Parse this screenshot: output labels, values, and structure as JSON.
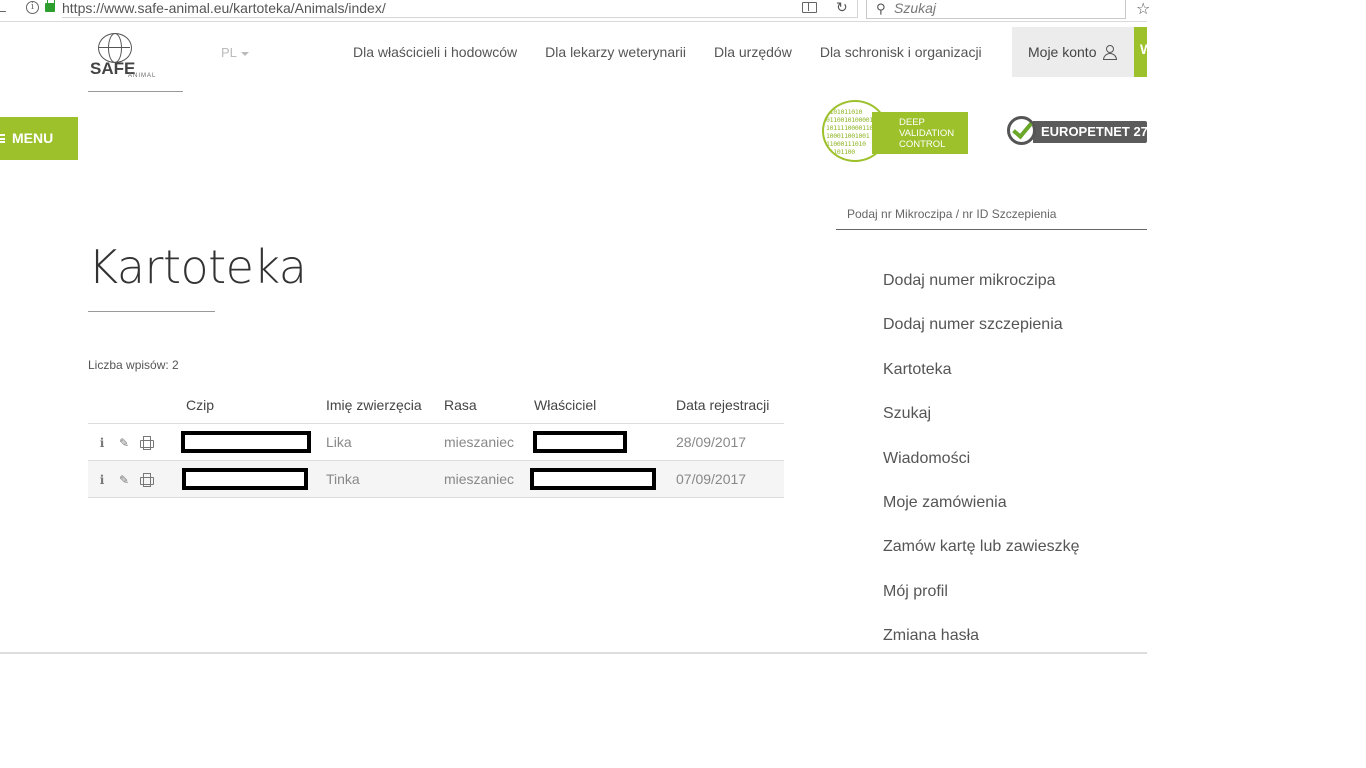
{
  "browser": {
    "url": "https://www.safe-animal.eu/kartoteka/Animals/index/",
    "search_placeholder": "Szukaj"
  },
  "logo": {
    "text": "SAFE",
    "sub": "ANIMAL"
  },
  "lang": "PL",
  "nav": {
    "items": [
      {
        "label": "Dla właścicieli i hodowców"
      },
      {
        "label": "Dla lekarzy weterynarii"
      },
      {
        "label": "Dla urzędów"
      },
      {
        "label": "Dla schronisk i organizacji"
      }
    ],
    "account": "Moje konto",
    "extra": "W"
  },
  "menu_label": "MENU",
  "badges": {
    "dvc_binary": "1101011010\n0110010100001\n10111100001100\n100011001001\n11000111010\n01101100",
    "dvc_lines": [
      "DEEP",
      "VALIDATION",
      "CONTROL"
    ],
    "europet": "EUROPETNET 27"
  },
  "chip_search": {
    "placeholder": "Podaj nr Mikroczipa / nr ID Szczepienia"
  },
  "side_menu": [
    "Dodaj numer mikroczipa",
    "Dodaj numer szczepienia",
    "Kartoteka",
    "Szukaj",
    "Wiadomości",
    "Moje zamówienia",
    "Zamów kartę lub zawieszkę",
    "Mój profil",
    "Zmiana hasła"
  ],
  "main": {
    "title": "Kartoteka",
    "count": "Liczba wpisów: 2",
    "columns": [
      "Czip",
      "Imię zwierzęcia",
      "Rasa",
      "Właściciel",
      "Data rejestracji"
    ],
    "rows": [
      {
        "name": "Lika",
        "breed": "mieszaniec",
        "date": "28/09/2017"
      },
      {
        "name": "Tinka",
        "breed": "mieszaniec",
        "date": "07/09/2017"
      }
    ]
  }
}
